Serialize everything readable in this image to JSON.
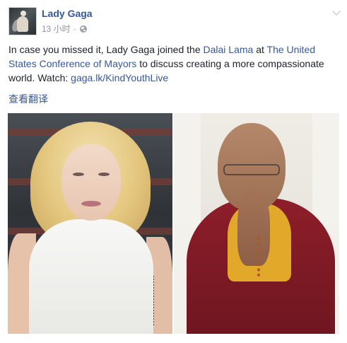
{
  "post": {
    "author": "Lady Gaga",
    "timestamp": "13 小时",
    "separator": "·",
    "privacy_icon": "globe-icon",
    "menu_icon": "chevron-down-icon",
    "message": {
      "text_1": "In case you missed it, Lady Gaga joined the ",
      "link_1": "Dalai Lama",
      "text_2": " at ",
      "link_2": "The United States Conference of Mayors",
      "text_3": " to discuss creating a more compassionate world. Watch: ",
      "link_3": "gaga.lk/KindYouthLive"
    },
    "see_translation": "查看翻译"
  },
  "colors": {
    "link": "#365899",
    "text": "#1d2129",
    "meta": "#90949c"
  }
}
